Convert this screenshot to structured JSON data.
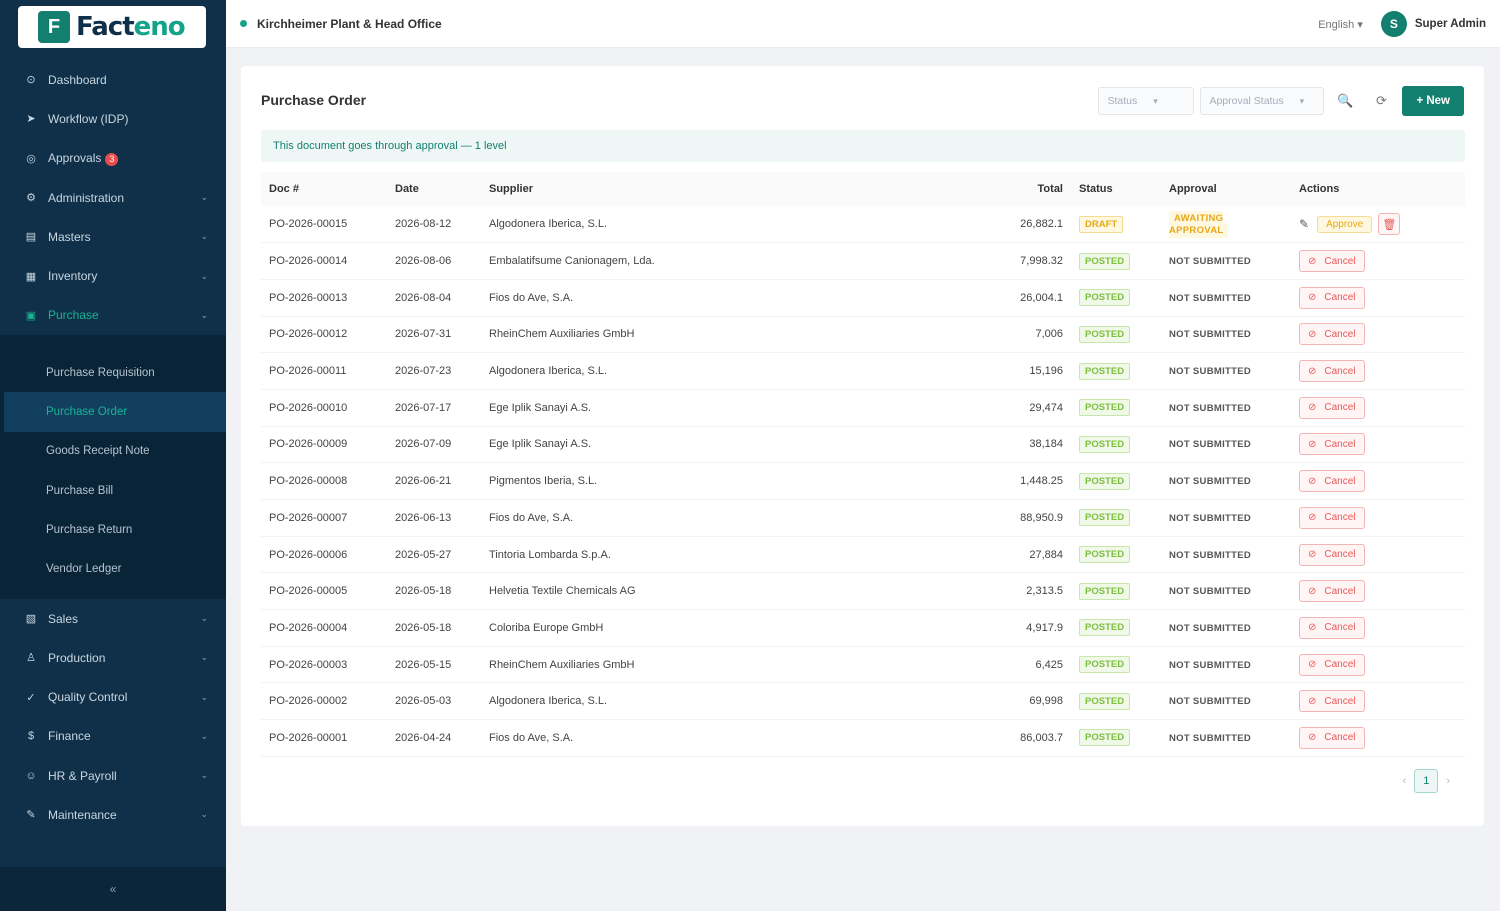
{
  "brand": {
    "name_part1": "Fact",
    "name_part2": "eno",
    "mark": "F"
  },
  "topbar": {
    "plant": "Kirchheimer Plant & Head Office",
    "language": "English",
    "language_caret": "▾",
    "user_initial": "S",
    "user_name": "Super Admin"
  },
  "sidebar": {
    "items": [
      {
        "label": "Dashboard",
        "icon": "⊙",
        "has_chevron": false
      },
      {
        "label": "Workflow (IDP)",
        "icon": "➤",
        "has_chevron": false
      },
      {
        "label": "Approvals",
        "icon": "◎",
        "has_chevron": false,
        "badge": "3"
      },
      {
        "label": "Administration",
        "icon": "⚙",
        "has_chevron": true
      },
      {
        "label": "Masters",
        "icon": "▤",
        "has_chevron": true
      },
      {
        "label": "Inventory",
        "icon": "▦",
        "has_chevron": true
      },
      {
        "label": "Purchase",
        "icon": "▣",
        "has_chevron": true,
        "open": true
      }
    ],
    "purchase_sub": [
      {
        "label": "Purchase Requisition"
      },
      {
        "label": "Purchase Order",
        "active": true
      },
      {
        "label": "Goods Receipt Note"
      },
      {
        "label": "Purchase Bill"
      },
      {
        "label": "Purchase Return"
      },
      {
        "label": "Vendor Ledger"
      }
    ],
    "items_after": [
      {
        "label": "Sales",
        "icon": "▧",
        "has_chevron": true
      },
      {
        "label": "Production",
        "icon": "♙",
        "has_chevron": true
      },
      {
        "label": "Quality Control",
        "icon": "✓",
        "has_chevron": true
      },
      {
        "label": "Finance",
        "icon": "$",
        "has_chevron": true
      },
      {
        "label": "HR & Payroll",
        "icon": "☺",
        "has_chevron": true
      },
      {
        "label": "Maintenance",
        "icon": "✎",
        "has_chevron": true
      }
    ],
    "collapse": "«",
    "chevron": "⌄"
  },
  "page": {
    "title": "Purchase Order",
    "status_filter": "Status",
    "approval_filter": "Approval Status",
    "search_icon": "🔍",
    "refresh_icon": "⟳",
    "new_button": "+ New",
    "info_text": "This document goes through approval — 1 level"
  },
  "table": {
    "headers": [
      "Doc #",
      "Date",
      "Supplier",
      "Total",
      "Status",
      "Approval",
      "Actions"
    ],
    "rows": [
      {
        "doc": "PO-2026-00015",
        "date": "2026-08-12",
        "supplier": "Algodonera Iberica, S.L.",
        "total": "26,882.1",
        "status": "DRAFT",
        "approval": "AWAITING APPROVAL"
      },
      {
        "doc": "PO-2026-00014",
        "date": "2026-08-06",
        "supplier": "Embalatifsume Canionagem, Lda.",
        "total": "7,998.32",
        "status": "POSTED",
        "approval": "NOT SUBMITTED"
      },
      {
        "doc": "PO-2026-00013",
        "date": "2026-08-04",
        "supplier": "Fios do Ave, S.A.",
        "total": "26,004.1",
        "status": "POSTED",
        "approval": "NOT SUBMITTED"
      },
      {
        "doc": "PO-2026-00012",
        "date": "2026-07-31",
        "supplier": "RheinChem Auxiliaries GmbH",
        "total": "7,006",
        "status": "POSTED",
        "approval": "NOT SUBMITTED"
      },
      {
        "doc": "PO-2026-00011",
        "date": "2026-07-23",
        "supplier": "Algodonera Iberica, S.L.",
        "total": "15,196",
        "status": "POSTED",
        "approval": "NOT SUBMITTED"
      },
      {
        "doc": "PO-2026-00010",
        "date": "2026-07-17",
        "supplier": "Ege Iplik Sanayi A.S.",
        "total": "29,474",
        "status": "POSTED",
        "approval": "NOT SUBMITTED"
      },
      {
        "doc": "PO-2026-00009",
        "date": "2026-07-09",
        "supplier": "Ege Iplik Sanayi A.S.",
        "total": "38,184",
        "status": "POSTED",
        "approval": "NOT SUBMITTED"
      },
      {
        "doc": "PO-2026-00008",
        "date": "2026-06-21",
        "supplier": "Pigmentos Iberia, S.L.",
        "total": "1,448.25",
        "status": "POSTED",
        "approval": "NOT SUBMITTED"
      },
      {
        "doc": "PO-2026-00007",
        "date": "2026-06-13",
        "supplier": "Fios do Ave, S.A.",
        "total": "88,950.9",
        "status": "POSTED",
        "approval": "NOT SUBMITTED"
      },
      {
        "doc": "PO-2026-00006",
        "date": "2026-05-27",
        "supplier": "Tintoria Lombarda S.p.A.",
        "total": "27,884",
        "status": "POSTED",
        "approval": "NOT SUBMITTED"
      },
      {
        "doc": "PO-2026-00005",
        "date": "2026-05-18",
        "supplier": "Helvetia Textile Chemicals AG",
        "total": "2,313.5",
        "status": "POSTED",
        "approval": "NOT SUBMITTED"
      },
      {
        "doc": "PO-2026-00004",
        "date": "2026-05-18",
        "supplier": "Coloriba Europe GmbH",
        "total": "4,917.9",
        "status": "POSTED",
        "approval": "NOT SUBMITTED"
      },
      {
        "doc": "PO-2026-00003",
        "date": "2026-05-15",
        "supplier": "RheinChem Auxiliaries GmbH",
        "total": "6,425",
        "status": "POSTED",
        "approval": "NOT SUBMITTED"
      },
      {
        "doc": "PO-2026-00002",
        "date": "2026-05-03",
        "supplier": "Algodonera Iberica, S.L.",
        "total": "69,998",
        "status": "POSTED",
        "approval": "NOT SUBMITTED"
      },
      {
        "doc": "PO-2026-00001",
        "date": "2026-04-24",
        "supplier": "Fios do Ave, S.A.",
        "total": "86,003.7",
        "status": "POSTED",
        "approval": "NOT SUBMITTED"
      }
    ],
    "cancel_label": "Cancel",
    "approve_label": "Approve",
    "cancel_icon": "⊘",
    "edit_icon": "✎",
    "delete_icon": "🗑"
  },
  "pagination": {
    "prev": "‹",
    "current": "1",
    "next": "›"
  }
}
